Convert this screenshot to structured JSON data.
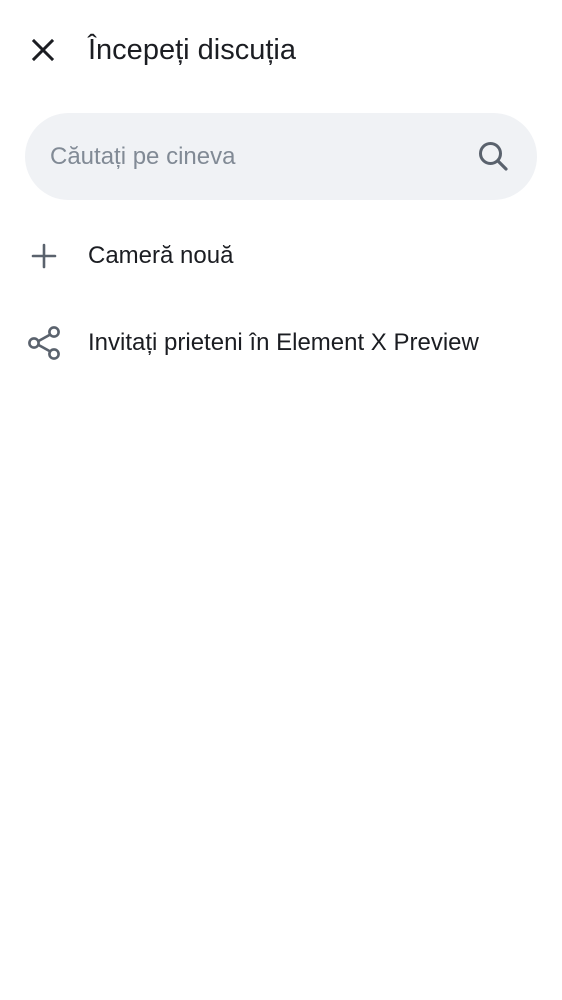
{
  "header": {
    "title": "Începeți discuția",
    "close_icon": "close-icon"
  },
  "search": {
    "placeholder": "Căutați pe cineva",
    "value": "",
    "icon": "search-icon"
  },
  "actions": [
    {
      "label": "Cameră nouă",
      "icon": "plus-icon"
    },
    {
      "label": "Invitați prieteni în Element X Preview",
      "icon": "share-icon"
    }
  ],
  "colors": {
    "background": "#ffffff",
    "text_primary": "#1b1d22",
    "icon": "#5a626d",
    "search_background": "#f0f2f5",
    "placeholder": "#818a95"
  }
}
